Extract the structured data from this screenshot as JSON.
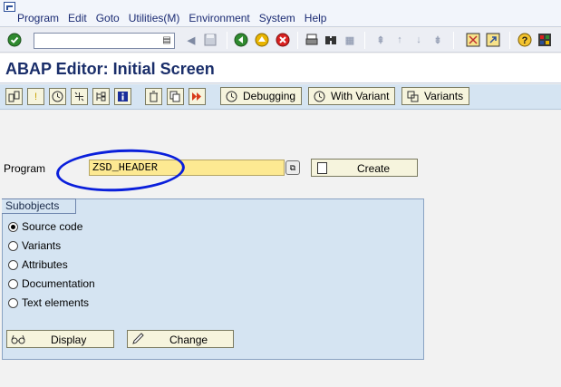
{
  "menu": {
    "items": [
      "Program",
      "Edit",
      "Goto",
      "Utilities(M)",
      "Environment",
      "System",
      "Help"
    ]
  },
  "toolbar": {
    "command_value": ""
  },
  "title": "ABAP Editor: Initial Screen",
  "app_toolbar": {
    "debugging_label": "Debugging",
    "with_variant_label": "With Variant",
    "variants_label": "Variants"
  },
  "program": {
    "label": "Program",
    "value": "ZSD_HEADER",
    "create_label": "Create"
  },
  "subobjects": {
    "title": "Subobjects",
    "options": [
      {
        "label": "Source code",
        "selected": true
      },
      {
        "label": "Variants",
        "selected": false
      },
      {
        "label": "Attributes",
        "selected": false
      },
      {
        "label": "Documentation",
        "selected": false
      },
      {
        "label": "Text elements",
        "selected": false
      }
    ],
    "display_label": "Display",
    "change_label": "Change"
  },
  "colors": {
    "title": "#1a2e6a",
    "menu_text": "#1b2b73",
    "app_toolbar_bg": "#d5e4f2",
    "required_field_bg": "#fde992",
    "annotation_circle": "#0a1fdb"
  }
}
